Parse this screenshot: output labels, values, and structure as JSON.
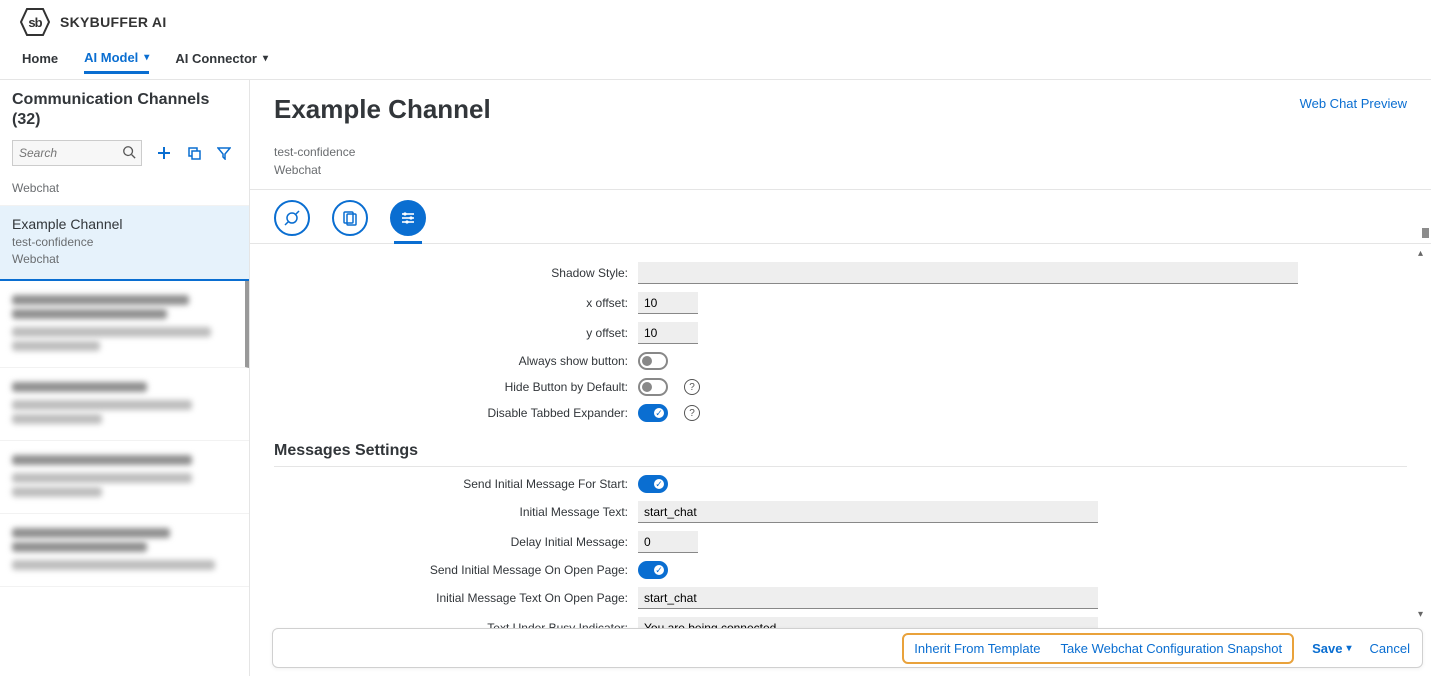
{
  "brand": "SKYBUFFER AI",
  "logo_text": "sb",
  "nav": {
    "home": "Home",
    "ai_model": "AI Model",
    "ai_connector": "AI Connector"
  },
  "sidebar": {
    "title": "Communication Channels (32)",
    "search_placeholder": "Search",
    "item0": {
      "sub": "Webchat"
    },
    "item1": {
      "title": "Example Channel",
      "sub1": "test-confidence",
      "sub2": "Webchat"
    }
  },
  "main": {
    "title": "Example Channel",
    "preview_link": "Web Chat Preview",
    "meta1": "test-confidence",
    "meta2": "Webchat"
  },
  "form": {
    "shadow_style_label": "Shadow Style:",
    "x_offset_label": "x offset:",
    "x_offset_value": "10",
    "y_offset_label": "y offset:",
    "y_offset_value": "10",
    "always_show_label": "Always show button:",
    "hide_button_label": "Hide Button by Default:",
    "disable_tabbed_label": "Disable Tabbed Expander:"
  },
  "section2": {
    "header": "Messages Settings",
    "row1_label": "Send Initial Message For Start:",
    "row2_label": "Initial Message Text:",
    "row2_value": "start_chat",
    "row3_label": "Delay Initial Message:",
    "row3_value": "0",
    "row4_label": "Send Initial Message On Open Page:",
    "row5_label": "Initial Message Text On Open Page:",
    "row5_value": "start_chat",
    "row6_label": "Text Under Busy Indicator:",
    "row6_value": "You are being connected..."
  },
  "footer": {
    "inherit": "Inherit From Template",
    "snapshot": "Take Webchat Configuration Snapshot",
    "save": "Save",
    "cancel": "Cancel"
  }
}
